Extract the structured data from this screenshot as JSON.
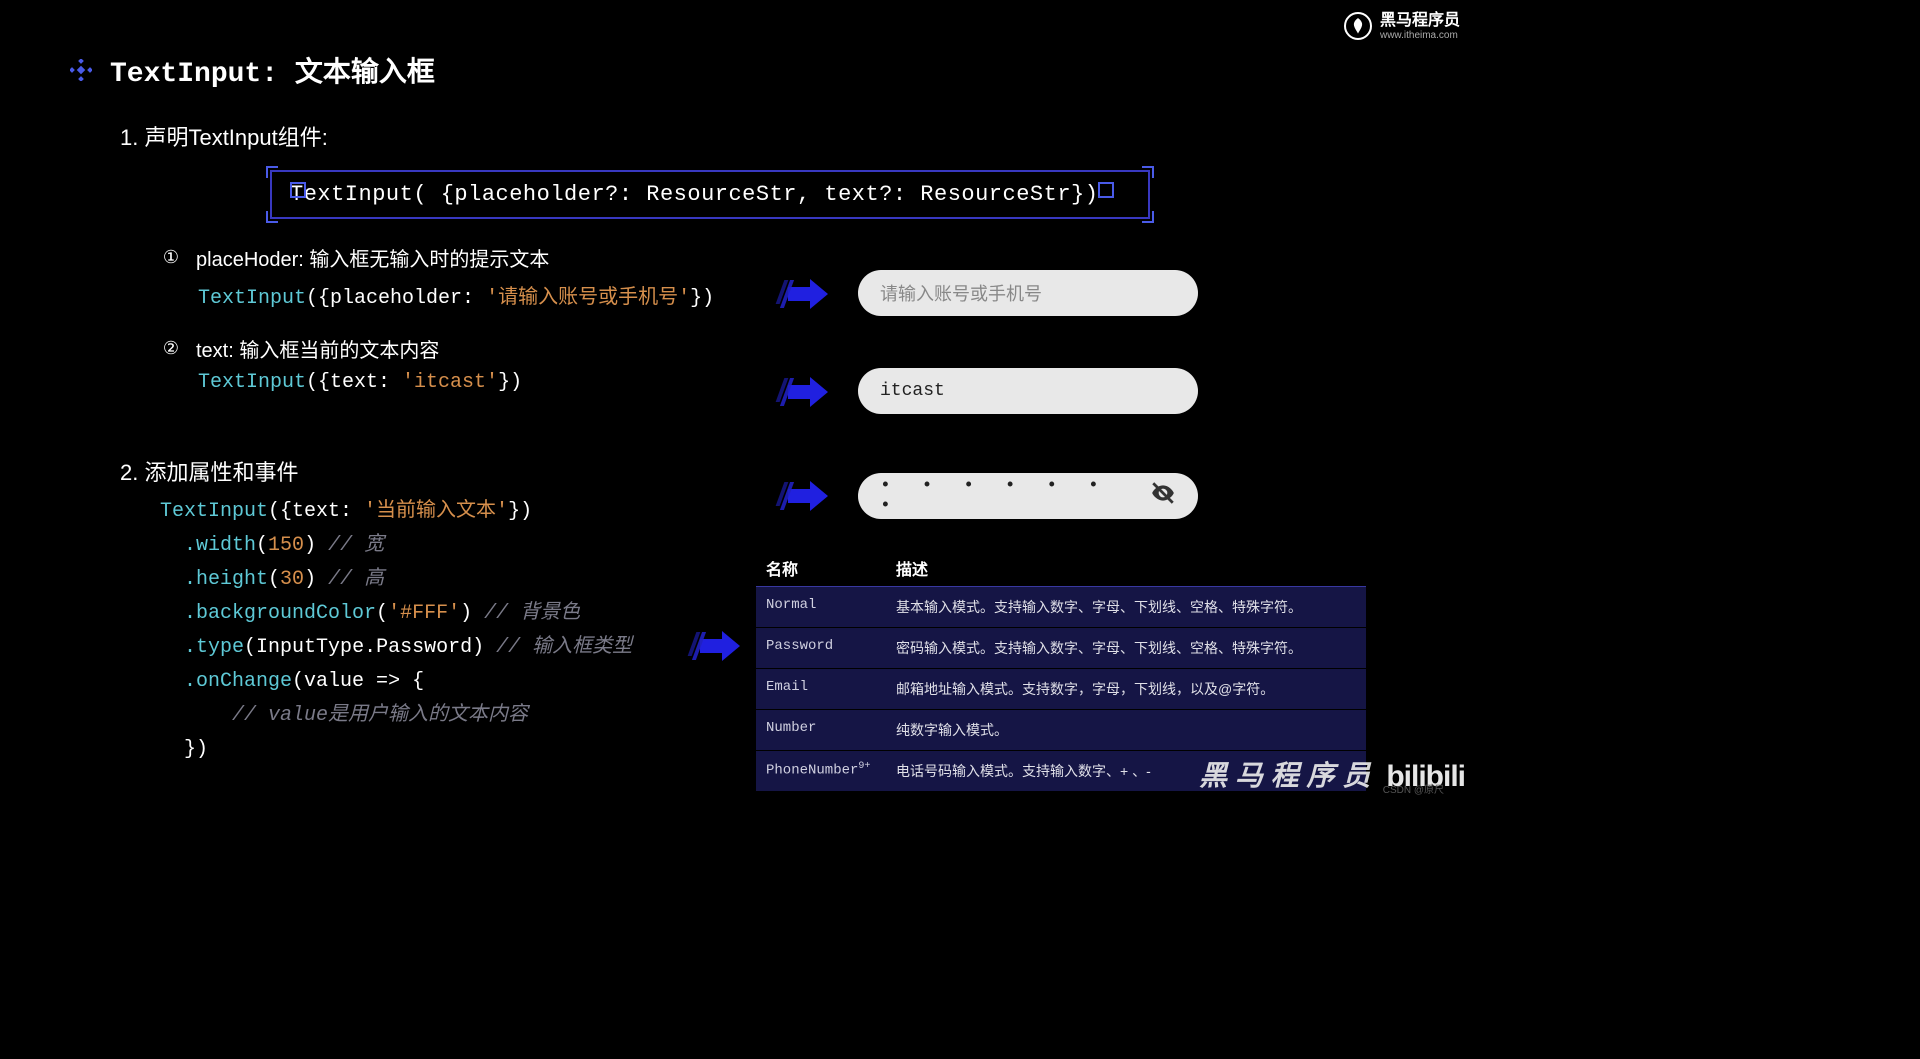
{
  "logo": {
    "name": "黑马程序员",
    "url": "www.itheima.com"
  },
  "title": "TextInput: 文本输入框",
  "section1": {
    "heading": "1. 声明TextInput组件:",
    "signature": "TextInput( {placeholder?: ResourceStr, text?: ResourceStr})",
    "items": [
      {
        "num": "①",
        "label": "placeHoder: 输入框无输入时的提示文本",
        "code": {
          "fn": "TextInput",
          "pre": "({placeholder: ",
          "str": "'请输入账号或手机号'",
          "post": "})"
        },
        "preview": "请输入账号或手机号"
      },
      {
        "num": "②",
        "label": "text: 输入框当前的文本内容",
        "code": {
          "fn": "TextInput",
          "pre": "({text: ",
          "str": "'itcast'",
          "post": "})"
        },
        "preview": "itcast"
      }
    ]
  },
  "section2": {
    "heading": "2. 添加属性和事件",
    "code": {
      "l1": {
        "fn": "TextInput",
        "pre": "({text: ",
        "str": "'当前输入文本'",
        "post": "})"
      },
      "l2": {
        "chain": ".width",
        "arg": "150",
        "comment": "// 宽"
      },
      "l3": {
        "chain": ".height",
        "arg": "30",
        "comment": "// 高"
      },
      "l4": {
        "chain": ".backgroundColor",
        "arg": "'#FFF'",
        "comment": "// 背景色"
      },
      "l5": {
        "chain": ".type",
        "arg": "InputType.Password",
        "comment": "// 输入框类型"
      },
      "l6": {
        "chain": ".onChange",
        "pre": "(value => {"
      },
      "l7": {
        "comment": "// value是用户输入的文本内容"
      },
      "l8": {
        "close": "})"
      }
    },
    "password_dots": "•  •  •  •  •  •  •"
  },
  "table": {
    "headers": [
      "名称",
      "描述"
    ],
    "rows": [
      {
        "name": "Normal",
        "sup": "",
        "desc": "基本输入模式。支持输入数字、字母、下划线、空格、特殊字符。"
      },
      {
        "name": "Password",
        "sup": "",
        "desc": "密码输入模式。支持输入数字、字母、下划线、空格、特殊字符。"
      },
      {
        "name": "Email",
        "sup": "",
        "desc": "邮箱地址输入模式。支持数字，字母，下划线，以及@字符。"
      },
      {
        "name": "Number",
        "sup": "",
        "desc": "纯数字输入模式。"
      },
      {
        "name": "PhoneNumber",
        "sup": "9+",
        "desc": "电话号码输入模式。支持输入数字、+ 、-"
      }
    ]
  },
  "watermark": {
    "brand": "黑 马 程 序 员",
    "site": "bilibili",
    "csdn": "CSDN @原尺"
  }
}
